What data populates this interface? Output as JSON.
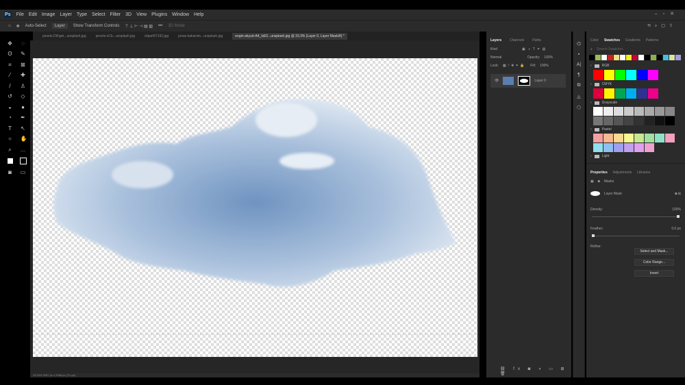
{
  "menu": [
    "File",
    "Edit",
    "Image",
    "Layer",
    "Type",
    "Select",
    "Filter",
    "3D",
    "View",
    "Plugins",
    "Window",
    "Help"
  ],
  "options": {
    "auto_select": "Auto-Select",
    "target": "Layer",
    "transform": "Show Transform Controls",
    "mode_3d": "3D Mode"
  },
  "tabs": [
    "pexels-DiFgwi...unsplash.jpg",
    "pexels-xCb...unsplash.jpg",
    "clipart57192.jpg",
    "jonas-kakaroto...unsplash.jpg",
    "engin-akyurt-A4_lsE0...unsplash.jpg @ 33.3% (Layer 0, Layer Mask/8) *"
  ],
  "status": "33.33%   3957 px x 2968 px (72 ppi)",
  "layers_panel": {
    "tabs": [
      "Layers",
      "Channels",
      "Paths"
    ],
    "filter": "Kind",
    "blend": "Normal",
    "opacity_label": "Opacity:",
    "opacity": "100%",
    "lock_label": "Lock:",
    "fill_label": "Fill:",
    "fill": "100%",
    "layer_name": "Layer 0"
  },
  "swatches_panel": {
    "tabs": [
      "Color",
      "Swatches",
      "Gradients",
      "Patterns"
    ],
    "search_placeholder": "Search Swatches",
    "recent": [
      "#000000",
      "#9bbb59",
      "#ffffff",
      "#cc2222",
      "#f0e080",
      "#ffffff",
      "#f0f020",
      "#cc0033",
      "#ffffff",
      "#000000",
      "#8cb04a",
      "#000000",
      "#40c0e0",
      "#e0e0a0",
      "#a0a0e0"
    ],
    "groups": [
      {
        "name": "RGB",
        "colors": [
          "#ff0000",
          "#ffff00",
          "#00ff00",
          "#00ffff",
          "#0000ff",
          "#ff00ff"
        ]
      },
      {
        "name": "CMYK",
        "colors": [
          "#e0003c",
          "#fff200",
          "#00a651",
          "#00aeef",
          "#2e3192",
          "#ec008c"
        ]
      },
      {
        "name": "Grayscale",
        "colors": [
          "#ffffff",
          "#eeeeee",
          "#dddddd",
          "#cccccc",
          "#bbbbbb",
          "#aaaaaa",
          "#999999",
          "#888888",
          "#777777",
          "#666666",
          "#555555",
          "#444444",
          "#333333",
          "#222222",
          "#111111",
          "#000000"
        ]
      },
      {
        "name": "Pastel",
        "colors": [
          "#f4a0a0",
          "#f8b890",
          "#fcd890",
          "#f8f890",
          "#c8e890",
          "#a0e0a0",
          "#90e0c8",
          "#f4a0c0",
          "#90e0f0",
          "#90c0f0",
          "#a0a0f0",
          "#c0a0f0",
          "#e0a0f0",
          "#f0a0d0"
        ]
      },
      {
        "name": "Light",
        "colors": []
      }
    ]
  },
  "properties": {
    "tabs": [
      "Properties",
      "Adjustments",
      "Libraries"
    ],
    "masks": "Masks",
    "layer_mask": "Layer Mask",
    "density_label": "Density:",
    "density": "100%",
    "density_value": 100,
    "feather_label": "Feather:",
    "feather": "0.0 px",
    "refine_label": "Refine:",
    "select_mask": "Select and Mask...",
    "color_range": "Color Range...",
    "invert": "Invert"
  }
}
